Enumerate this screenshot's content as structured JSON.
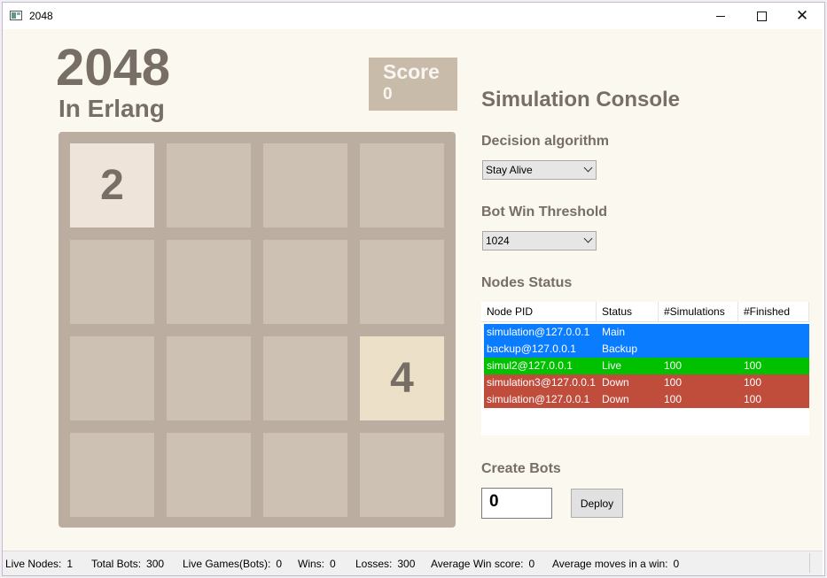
{
  "window": {
    "title": "2048"
  },
  "game": {
    "title": "2048",
    "subtitle": "In Erlang",
    "score_label": "Score",
    "score_value": "0",
    "board": [
      [
        "2",
        "",
        "",
        ""
      ],
      [
        "",
        "",
        "",
        ""
      ],
      [
        "",
        "",
        "",
        "4"
      ],
      [
        "",
        "",
        "",
        ""
      ]
    ]
  },
  "console": {
    "title": "Simulation Console",
    "decision_label": "Decision algorithm",
    "decision_value": "Stay Alive",
    "threshold_label": "Bot Win Threshold",
    "threshold_value": "1024",
    "nodes_label": "Nodes Status",
    "columns": [
      "Node PID",
      "Status",
      "#Simulations",
      "#Finished"
    ],
    "nodes": [
      {
        "pid": "simulation@127.0.0.1",
        "status": "Main",
        "simulations": "",
        "finished": "",
        "color": "#0a7cff"
      },
      {
        "pid": "backup@127.0.0.1",
        "status": "Backup",
        "simulations": "",
        "finished": "",
        "color": "#0a7cff"
      },
      {
        "pid": "simul2@127.0.0.1",
        "status": "Live",
        "simulations": "100",
        "finished": "100",
        "color": "#00c000"
      },
      {
        "pid": "simulation3@127.0.0.1",
        "status": "Down",
        "simulations": "100",
        "finished": "100",
        "color": "#c04c3c"
      },
      {
        "pid": "simulation@127.0.0.1",
        "status": "Down",
        "simulations": "100",
        "finished": "100",
        "color": "#c04c3c"
      }
    ],
    "create_label": "Create Bots",
    "bots_value": "0",
    "deploy_label": "Deploy"
  },
  "status": {
    "live_nodes_label": "Live Nodes:",
    "live_nodes": "1",
    "total_bots_label": "Total Bots:",
    "total_bots": "300",
    "live_games_label": "Live Games(Bots):",
    "live_games": "0",
    "wins_label": "Wins:",
    "wins": "0",
    "losses_label": "Losses:",
    "losses": "300",
    "avg_win_score_label": "Average Win score:",
    "avg_win_score": "0",
    "avg_moves_label": "Average moves in a win:",
    "avg_moves": "0"
  },
  "colors": {
    "tile_2": "#eee4da",
    "tile_4": "#ede0c8",
    "empty": "#cdc1b4",
    "board": "#bbada0",
    "text": "#776e65"
  }
}
